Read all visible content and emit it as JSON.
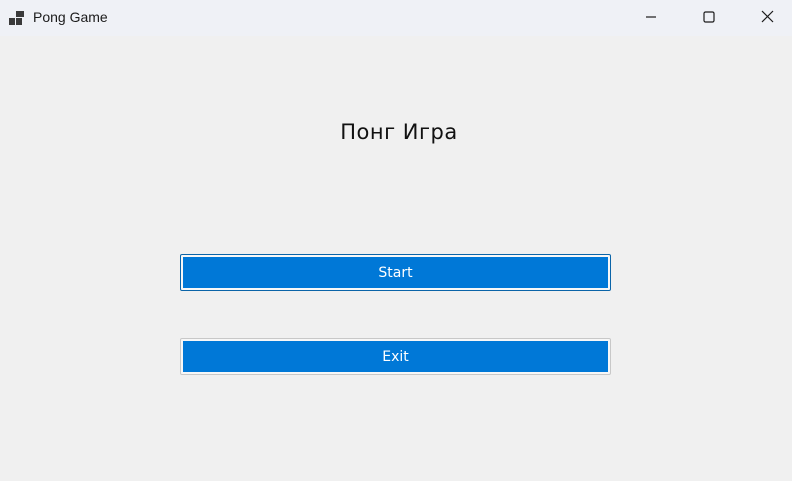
{
  "window": {
    "title": "Pong Game",
    "icon": "app-window-icon",
    "controls": {
      "minimize_icon": "minimize-icon",
      "maximize_icon": "maximize-icon",
      "close_icon": "close-icon"
    }
  },
  "main": {
    "heading": "Понг Игра",
    "start_label": "Start",
    "exit_label": "Exit"
  },
  "colors": {
    "button_blue": "#0078d7",
    "background": "#f0f0f0",
    "titlebar": "#eff1f6"
  }
}
